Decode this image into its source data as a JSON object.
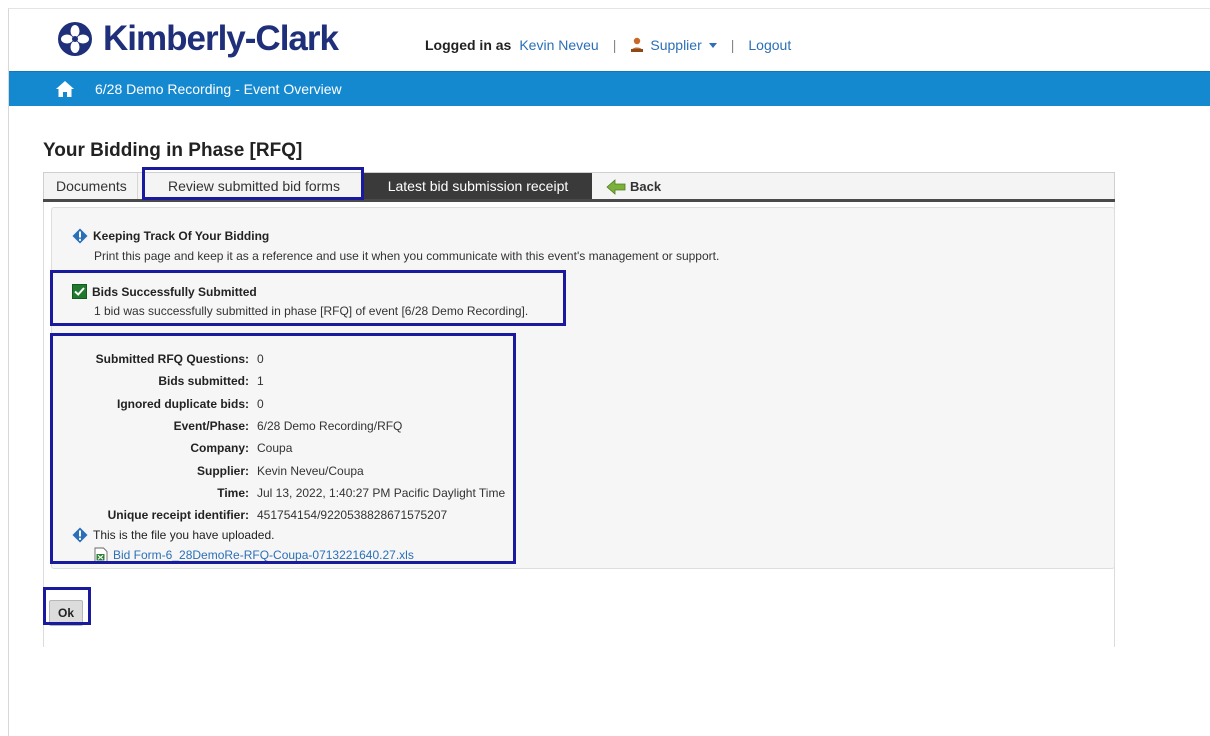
{
  "header": {
    "logo_text": "Kimberly-Clark",
    "logged_in_label": "Logged in as",
    "user_name": "Kevin Neveu",
    "role_menu": "Supplier",
    "separator": "|",
    "logout": "Logout"
  },
  "nav": {
    "home_icon": "home-icon",
    "title": "6/28 Demo Recording - Event Overview",
    "bar_color": "#1589d0"
  },
  "page": {
    "title": "Your Bidding in Phase [RFQ]"
  },
  "tabs": {
    "documents": "Documents",
    "review": "Review submitted bid forms",
    "latest": "Latest bid submission receipt",
    "back": "Back"
  },
  "keeping_track": {
    "title": "Keeping Track Of Your Bidding",
    "text": "Print this page and keep it as a reference and use it when you communicate with this event's management or support."
  },
  "bids_success": {
    "title": "Bids Successfully Submitted",
    "text": "1 bid was successfully submitted in phase [RFQ] of event [6/28 Demo Recording]."
  },
  "details": [
    {
      "label": "Submitted RFQ Questions:",
      "value": "0"
    },
    {
      "label": "Bids submitted:",
      "value": "1"
    },
    {
      "label": "Ignored duplicate bids:",
      "value": "0"
    },
    {
      "label": "Event/Phase:",
      "value": "6/28 Demo Recording/RFQ"
    },
    {
      "label": "Company:",
      "value": "Coupa"
    },
    {
      "label": "Supplier:",
      "value": "Kevin Neveu/Coupa"
    },
    {
      "label": "Time:",
      "value": "Jul 13, 2022, 1:40:27 PM Pacific Daylight Time"
    },
    {
      "label": "Unique receipt identifier:",
      "value": "451754154/9220538828671575207"
    }
  ],
  "upload": {
    "note": "This is the file you have uploaded.",
    "file_name": "Bid Form-6_28DemoRe-RFQ-Coupa-0713221640.27.xls"
  },
  "actions": {
    "ok": "Ok"
  },
  "colors": {
    "highlight": "#1a1a9e",
    "link": "#2a6fb8",
    "brand": "#1f2f7a"
  }
}
